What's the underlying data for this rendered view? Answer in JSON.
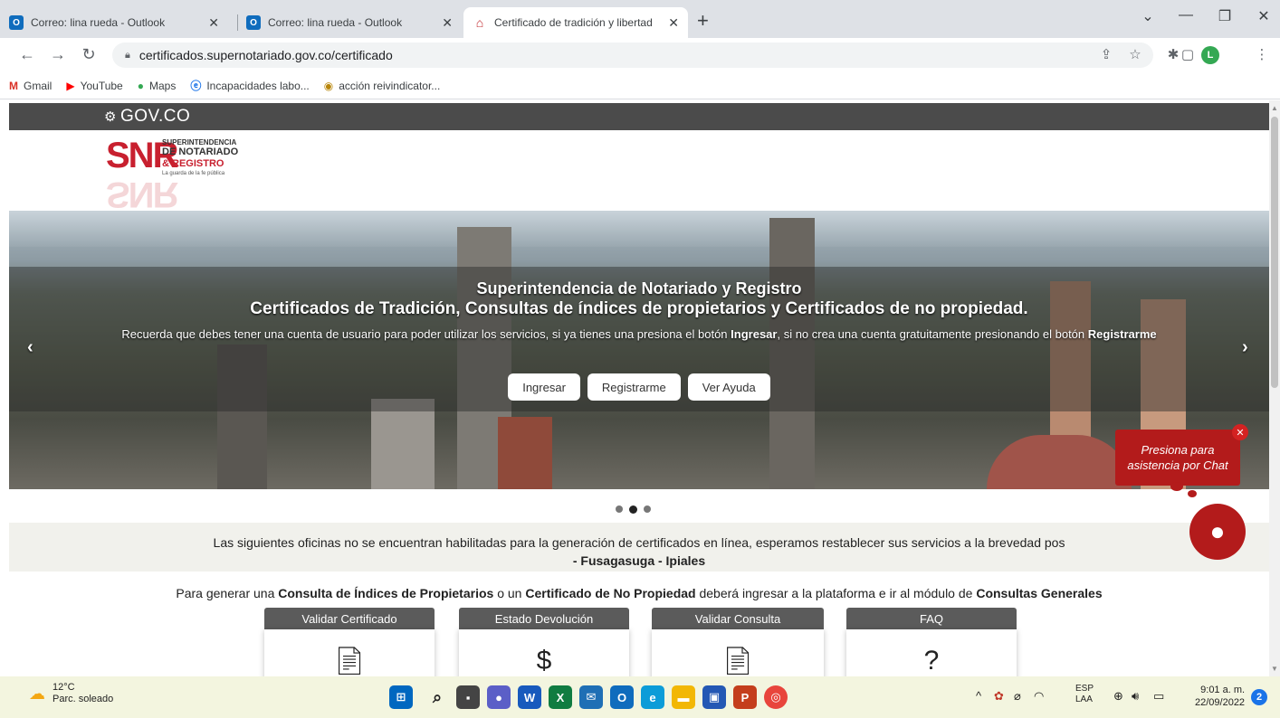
{
  "browser": {
    "tabs": [
      {
        "label": "Correo: lina rueda - Outlook",
        "icon": "outlook-icon",
        "active": false
      },
      {
        "label": "Correo: lina rueda - Outlook",
        "icon": "outlook-icon",
        "active": false
      },
      {
        "label": "Certificado de tradición y libertad",
        "icon": "snr-icon",
        "active": true
      }
    ],
    "url": "certificados.supernotariado.gov.co/certificado",
    "bookmarks": [
      {
        "label": "Gmail",
        "icon": "gmail-icon"
      },
      {
        "label": "YouTube",
        "icon": "youtube-icon"
      },
      {
        "label": "Maps",
        "icon": "maps-icon"
      },
      {
        "label": "Incapacidades labo...",
        "icon": "ie-icon"
      },
      {
        "label": "acción reivindicator...",
        "icon": "seal-icon"
      }
    ],
    "profile_initial": "L"
  },
  "page": {
    "gov_brand": "GOV.CO",
    "logo": {
      "big": "SNR",
      "line1": "SUPERINTENDENCIA",
      "line2": "DE NOTARIADO",
      "line3": "& REGISTRO",
      "line4": "La guarda de la fe pública"
    },
    "hero": {
      "title1": "Superintendencia de Notariado y Registro",
      "title2": "Certificados de Tradición, Consultas de índices de propietarios y Certificados de no propiedad.",
      "text_part1": "Recuerda que debes tener una cuenta de usuario para poder utilizar los servicios, si ya tienes una presiona el botón ",
      "text_bold1": "Ingresar",
      "text_part2": ", si no crea una cuenta gratuitamente presionando el botón ",
      "text_bold2": "Registrarme",
      "buttons": [
        "Ingresar",
        "Registrarme",
        "Ver Ayuda"
      ],
      "arrow_left": "‹",
      "arrow_right": "›"
    },
    "notice": {
      "line1": "Las siguientes oficinas no se encuentran habilitadas para la generación de certificados en línea, esperamos restablecer sus servicios a la brevedad pos",
      "line2": "- Fusagasuga - Ipiales"
    },
    "consult": {
      "p1": "Para generar una ",
      "b1": "Consulta de Índices de Propietarios",
      "p2": " o un ",
      "b2": "Certificado de No Propiedad",
      "p3": " deberá ingresar a la plataforma e ir al módulo de ",
      "b3": "Consultas Generales"
    },
    "cards": [
      {
        "label": "Validar Certificado",
        "icon": "certificate-check-icon"
      },
      {
        "label": "Estado Devolución",
        "icon": "money-refund-icon"
      },
      {
        "label": "Validar Consulta",
        "icon": "document-check-icon"
      },
      {
        "label": "FAQ",
        "icon": "cloud-question-icon"
      }
    ],
    "chat": {
      "line1": "Presiona para",
      "line2": "asistencia por Chat"
    }
  },
  "taskbar": {
    "weather_temp": "12°C",
    "weather_desc": "Parc. soleado",
    "lang1": "ESP",
    "lang2": "LAA",
    "time": "9:01 a. m.",
    "date": "22/09/2022",
    "notifications": "2"
  }
}
